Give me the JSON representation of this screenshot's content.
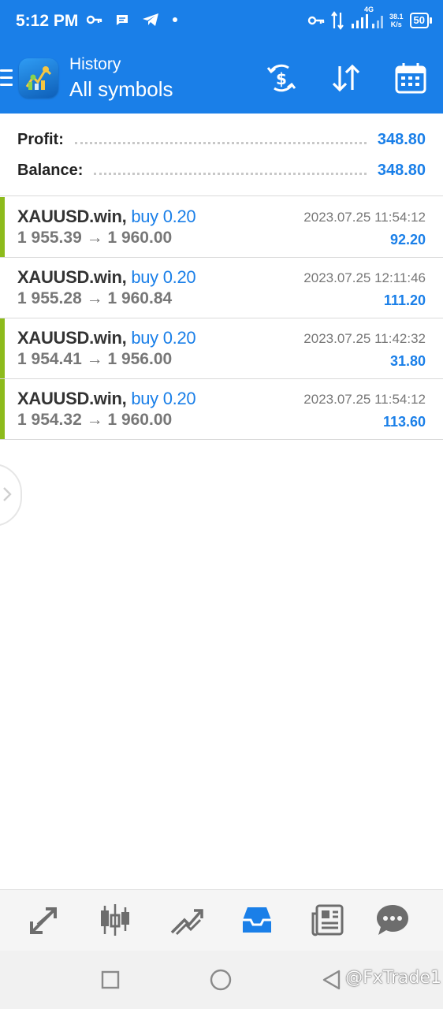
{
  "status_bar": {
    "time": "5:12 PM",
    "network_type": "4G",
    "net_speed_value": "38.1",
    "net_speed_unit": "K/s",
    "battery_level": "50",
    "icons": [
      "key-icon",
      "message-icon",
      "telegram-icon",
      "dot-icon",
      "vpn-key-icon",
      "data-arrows-icon",
      "signal-icon",
      "signal-icon-2",
      "battery-icon"
    ]
  },
  "app_bar": {
    "title": "History",
    "subtitle": "All symbols",
    "icons": [
      "menu-icon",
      "app-logo",
      "dollar-refresh-icon",
      "sort-icon",
      "calendar-icon"
    ]
  },
  "summary": {
    "profit_label": "Profit:",
    "profit_value": "348.80",
    "balance_label": "Balance:",
    "balance_value": "348.80"
  },
  "trades": [
    {
      "symbol": "XAUUSD.win,",
      "type": "buy 0.20",
      "open_price": "1 955.39",
      "arrow": "→",
      "close_price": "1 960.00",
      "time": "2023.07.25 11:54:12",
      "profit": "92.20",
      "accent": true
    },
    {
      "symbol": "XAUUSD.win,",
      "type": "buy 0.20",
      "open_price": "1 955.28",
      "arrow": "→",
      "close_price": "1 960.84",
      "time": "2023.07.25 12:11:46",
      "profit": "111.20",
      "accent": false
    },
    {
      "symbol": "XAUUSD.win,",
      "type": "buy 0.20",
      "open_price": "1 954.41",
      "arrow": "→",
      "close_price": "1 956.00",
      "time": "2023.07.25 11:42:32",
      "profit": "31.80",
      "accent": true
    },
    {
      "symbol": "XAUUSD.win,",
      "type": "buy 0.20",
      "open_price": "1 954.32",
      "arrow": "→",
      "close_price": "1 960.00",
      "time": "2023.07.25 11:54:12",
      "profit": "113.60",
      "accent": true
    }
  ],
  "bottom_nav": {
    "items": [
      "quotes-icon",
      "chart-icon",
      "trade-icon",
      "history-icon",
      "news-icon",
      "messages-icon"
    ],
    "active": "history-icon"
  },
  "system_nav": {
    "items": [
      "recents-icon",
      "home-icon",
      "back-icon"
    ],
    "watermark": "@FxTrade1"
  },
  "colors": {
    "primary": "#1a7fe8",
    "accent_green": "#8dbb1c",
    "text_dark": "#333333",
    "text_gray": "#777777"
  }
}
